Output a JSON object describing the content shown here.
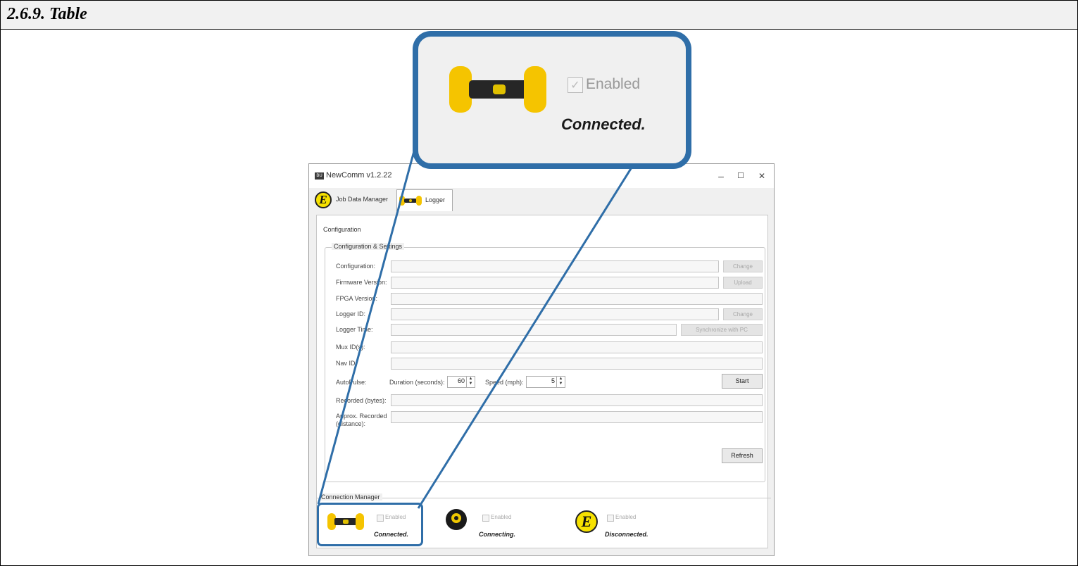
{
  "header": {
    "title": "2.6.9. Table"
  },
  "window": {
    "title": "NewComm v1.2.22",
    "icon_text": "BU",
    "controls": {
      "minimize": "–",
      "maximize": "☐",
      "close": "✕"
    },
    "tabs": [
      {
        "label": "Job Data Manager",
        "icon": "e-logo-icon"
      },
      {
        "label": "Logger",
        "icon": "logger-icon"
      }
    ]
  },
  "config": {
    "page_label": "Configuration",
    "group_title": "Configuration & Settings",
    "rows": {
      "configuration": "Configuration:",
      "firmware": "Firmware Version:",
      "fpga": "FPGA Version:",
      "logger_id": "Logger ID:",
      "logger_time": "Logger Time:",
      "mux_id": "Mux ID(s):",
      "nav_id": "Nav ID:",
      "autopulse": "AutoPulse:",
      "recorded_bytes": "Recorded (bytes):",
      "approx_line1": "Approx. Recorded",
      "approx_line2": "(distance):"
    },
    "buttons": {
      "change_config": "Change",
      "upload": "Upload",
      "change_id": "Change",
      "sync": "Synchronize with PC",
      "start": "Start",
      "refresh": "Refresh"
    },
    "autopulse": {
      "duration_label": "Duration (seconds):",
      "duration_value": "60",
      "speed_label": "Speed (mph):",
      "speed_value": "5"
    }
  },
  "connection_manager": {
    "title": "Connection Manager",
    "items": [
      {
        "icon": "logger-icon",
        "checkbox": "Enabled",
        "status": "Connected."
      },
      {
        "icon": "radio-icon",
        "checkbox": "Enabled",
        "status": "Connecting."
      },
      {
        "icon": "e-logo-icon",
        "checkbox": "Enabled",
        "status": "Disconnected."
      }
    ]
  },
  "zoom_callout": {
    "checkbox": "Enabled",
    "status": "Connected."
  },
  "colors": {
    "callout": "#2f6ea8",
    "logger_yellow": "#f5c400",
    "e_logo_yellow": "#f6e100"
  }
}
